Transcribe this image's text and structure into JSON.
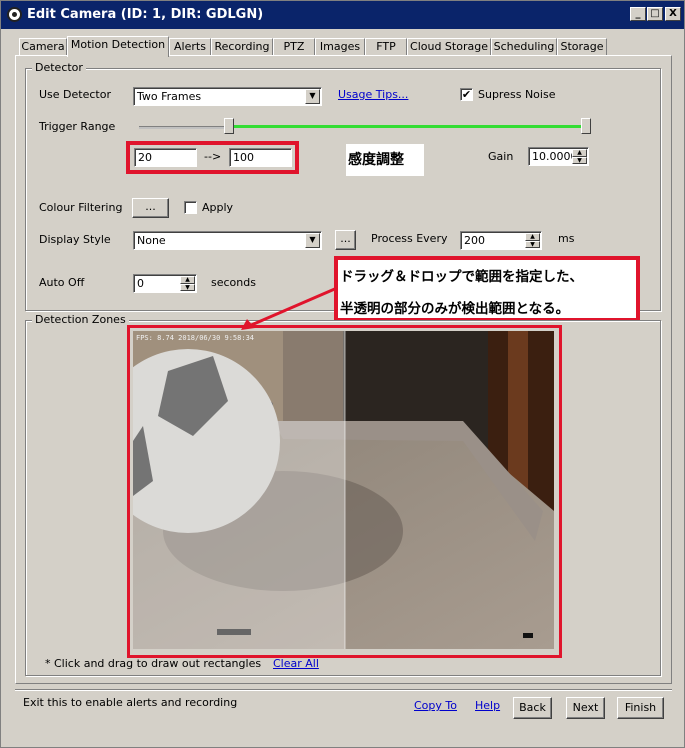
{
  "window": {
    "title": "Edit Camera (ID: 1, DIR: GDLGN)",
    "controls": [
      "_",
      "□",
      "X"
    ]
  },
  "tabs": [
    "Camera",
    "Motion Detection",
    "Alerts",
    "Recording",
    "PTZ",
    "Images",
    "FTP",
    "Cloud Storage",
    "Scheduling",
    "Storage"
  ],
  "detector": {
    "group_label": "Detector",
    "use_detector_label": "Use Detector",
    "use_detector_value": "Two Frames",
    "usage_tips": "Usage Tips...",
    "supress_noise_label": "Supress Noise",
    "supress_noise_checked": "✔",
    "trigger_range_label": "Trigger Range",
    "trigger_min": "20",
    "trigger_arrow": "-->",
    "trigger_max": "100",
    "gain_label": "Gain",
    "gain_value": "10.0000",
    "colour_filtering_label": "Colour Filtering",
    "colour_button": "...",
    "apply_label": "Apply",
    "display_style_label": "Display Style",
    "display_style_value": "None",
    "display_button": "...",
    "process_every_label": "Process Every",
    "process_every_value": "200",
    "ms_label": "ms",
    "auto_off_label": "Auto Off",
    "auto_off_value": "0",
    "seconds_label": "seconds"
  },
  "annotations": {
    "sensitivity_note": "感度調整",
    "drag_note_line1": "ドラッグ＆ドロップで範囲を指定した、",
    "drag_note_line2": "半透明の部分のみが検出範囲となる。",
    "accent_color": "#e0142c"
  },
  "zones": {
    "group_label": "Detection Zones",
    "overlay_text": "FPS: 8.74 2018/06/30 9:58:34",
    "hint": "* Click and drag to draw out rectangles",
    "clear_all": "Clear All"
  },
  "footer": {
    "status": "Exit this to enable alerts and recording",
    "copy_to": "Copy To",
    "help": "Help",
    "back": "Back",
    "next": "Next",
    "finish": "Finish"
  }
}
